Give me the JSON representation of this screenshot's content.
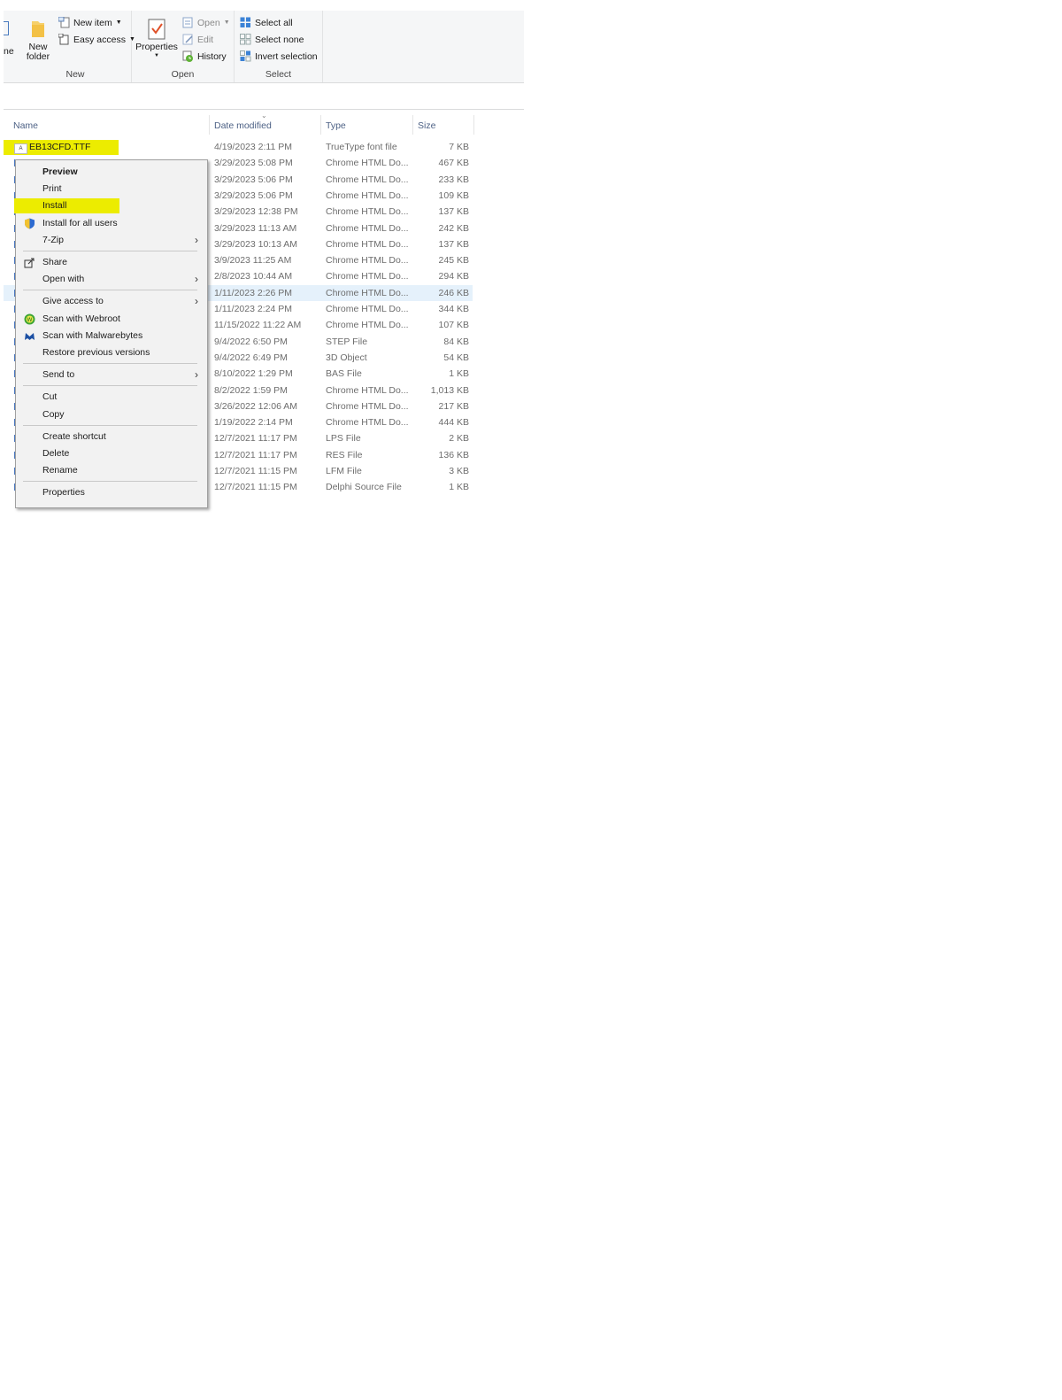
{
  "ribbon": {
    "partial_label": "ne",
    "new_group": {
      "label": "New",
      "new_folder_label": "New\nfolder",
      "new_item_label": "New item",
      "easy_access_label": "Easy access"
    },
    "open_group": {
      "label": "Open",
      "properties_label": "Properties",
      "open_label": "Open",
      "edit_label": "Edit",
      "history_label": "History"
    },
    "select_group": {
      "label": "Select",
      "select_all_label": "Select all",
      "select_none_label": "Select none",
      "invert_selection_label": "Invert selection"
    }
  },
  "columns": {
    "name": "Name",
    "date_modified": "Date modified",
    "type": "Type",
    "size": "Size"
  },
  "files": [
    {
      "name": "EB13CFD.TTF",
      "date": "4/19/2023 2:11 PM",
      "type": "TrueType font file",
      "size": "7 KB"
    },
    {
      "name": "",
      "date": "3/29/2023 5:08 PM",
      "type": "Chrome HTML Do...",
      "size": "467 KB"
    },
    {
      "name": "",
      "date": "3/29/2023 5:06 PM",
      "type": "Chrome HTML Do...",
      "size": "233 KB"
    },
    {
      "name": "",
      "date": "3/29/2023 5:06 PM",
      "type": "Chrome HTML Do...",
      "size": "109 KB"
    },
    {
      "name": "",
      "date": "3/29/2023 12:38 PM",
      "type": "Chrome HTML Do...",
      "size": "137 KB"
    },
    {
      "name": "",
      "date": "3/29/2023 11:13 AM",
      "type": "Chrome HTML Do...",
      "size": "242 KB"
    },
    {
      "name": "",
      "date": "3/29/2023 10:13 AM",
      "type": "Chrome HTML Do...",
      "size": "137 KB"
    },
    {
      "name": "",
      "date": "3/9/2023 11:25 AM",
      "type": "Chrome HTML Do...",
      "size": "245 KB"
    },
    {
      "name": "",
      "date": "2/8/2023 10:44 AM",
      "type": "Chrome HTML Do...",
      "size": "294 KB"
    },
    {
      "name": "",
      "date": "1/11/2023 2:26 PM",
      "type": "Chrome HTML Do...",
      "size": "246 KB",
      "selected": true
    },
    {
      "name": "",
      "date": "1/11/2023 2:24 PM",
      "type": "Chrome HTML Do...",
      "size": "344 KB"
    },
    {
      "name": "",
      "date": "11/15/2022 11:22 AM",
      "type": "Chrome HTML Do...",
      "size": "107 KB"
    },
    {
      "name": "",
      "date": "9/4/2022 6:50 PM",
      "type": "STEP File",
      "size": "84 KB"
    },
    {
      "name": "",
      "date": "9/4/2022 6:49 PM",
      "type": "3D Object",
      "size": "54 KB"
    },
    {
      "name": "",
      "date": "8/10/2022 1:29 PM",
      "type": "BAS File",
      "size": "1 KB"
    },
    {
      "name": "",
      "date": "8/2/2022 1:59 PM",
      "type": "Chrome HTML Do...",
      "size": "1,013 KB"
    },
    {
      "name": "",
      "date": "3/26/2022 12:06 AM",
      "type": "Chrome HTML Do...",
      "size": "217 KB"
    },
    {
      "name": "",
      "date": "1/19/2022 2:14 PM",
      "type": "Chrome HTML Do...",
      "size": "444 KB"
    },
    {
      "name": "",
      "date": "12/7/2021 11:17 PM",
      "type": "LPS File",
      "size": "2 KB"
    },
    {
      "name": "",
      "date": "12/7/2021 11:17 PM",
      "type": "RES File",
      "size": "136 KB"
    },
    {
      "name": "",
      "date": "12/7/2021 11:15 PM",
      "type": "LFM File",
      "size": "3 KB"
    },
    {
      "name": "",
      "date": "12/7/2021 11:15 PM",
      "type": "Delphi Source File",
      "size": "1 KB"
    }
  ],
  "context_menu": {
    "items": [
      {
        "label": "Preview",
        "bold": true
      },
      {
        "label": "Print"
      },
      {
        "label": "Install",
        "highlighted": true
      },
      {
        "label": "Install for all users",
        "icon": "shield-icon"
      },
      {
        "label": "7-Zip",
        "submenu": true
      },
      {
        "separator": true
      },
      {
        "label": "Share",
        "icon": "share-icon"
      },
      {
        "label": "Open with",
        "submenu": true
      },
      {
        "separator": true
      },
      {
        "label": "Give access to",
        "submenu": true
      },
      {
        "label": "Scan with Webroot",
        "icon": "webroot-icon"
      },
      {
        "label": "Scan with Malwarebytes",
        "icon": "malwarebytes-icon"
      },
      {
        "label": "Restore previous versions"
      },
      {
        "separator": true
      },
      {
        "label": "Send to",
        "submenu": true
      },
      {
        "separator": true
      },
      {
        "label": "Cut"
      },
      {
        "label": "Copy"
      },
      {
        "separator": true
      },
      {
        "label": "Create shortcut"
      },
      {
        "label": "Delete"
      },
      {
        "label": "Rename"
      },
      {
        "separator": true
      },
      {
        "label": "Properties"
      }
    ]
  },
  "colors": {
    "highlight": "#ecec00",
    "selected_row": "#e5f1fb",
    "column_header": "#4d6185"
  }
}
